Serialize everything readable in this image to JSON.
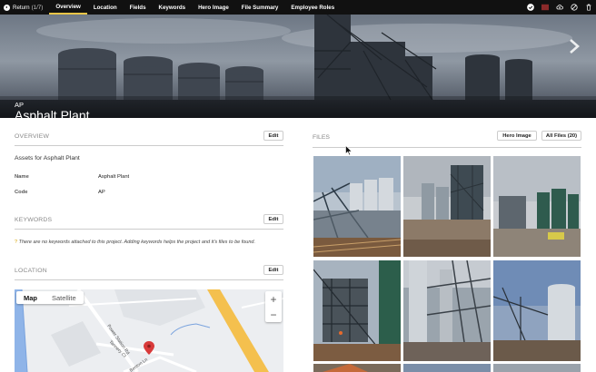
{
  "nav": {
    "return_label": "Return",
    "return_count": "(1/7)",
    "tabs": [
      "Overview",
      "Location",
      "Fields",
      "Keywords",
      "Hero Image",
      "File Summary",
      "Employee Roles"
    ],
    "active_tab": "Overview"
  },
  "top_icons": [
    "check-icon",
    "color-swatch-icon",
    "cloud-upload-icon",
    "block-icon",
    "trash-icon"
  ],
  "colors": {
    "active_tab_underline": "#e8c547",
    "swatch": "#8b2a2a",
    "map_pin": "#d83a3a",
    "highway": "#f4c04e"
  },
  "hero": {
    "code": "AP",
    "title": "Asphalt Plant"
  },
  "overview": {
    "heading": "OVERVIEW",
    "edit_label": "Edit",
    "description": "Assets for Asphalt Plant",
    "fields": [
      {
        "label": "Name",
        "value": "Asphalt Plant"
      },
      {
        "label": "Code",
        "value": "AP"
      }
    ]
  },
  "keywords": {
    "heading": "KEYWORDS",
    "edit_label": "Edit",
    "note_icon": "?",
    "note": "There are no keywords attached to this project. Adding keywords helps the project and it's files to be found."
  },
  "location": {
    "heading": "LOCATION",
    "edit_label": "Edit",
    "map_tab": "Map",
    "satellite_tab": "Satellite",
    "zoom_in": "+",
    "zoom_out": "−",
    "streets": [
      "Power Station Rd",
      "Tannery Ct",
      "Benton Ln"
    ]
  },
  "files": {
    "heading": "FILES",
    "hero_image_label": "Hero Image",
    "all_files_label": "All Files (20)"
  }
}
